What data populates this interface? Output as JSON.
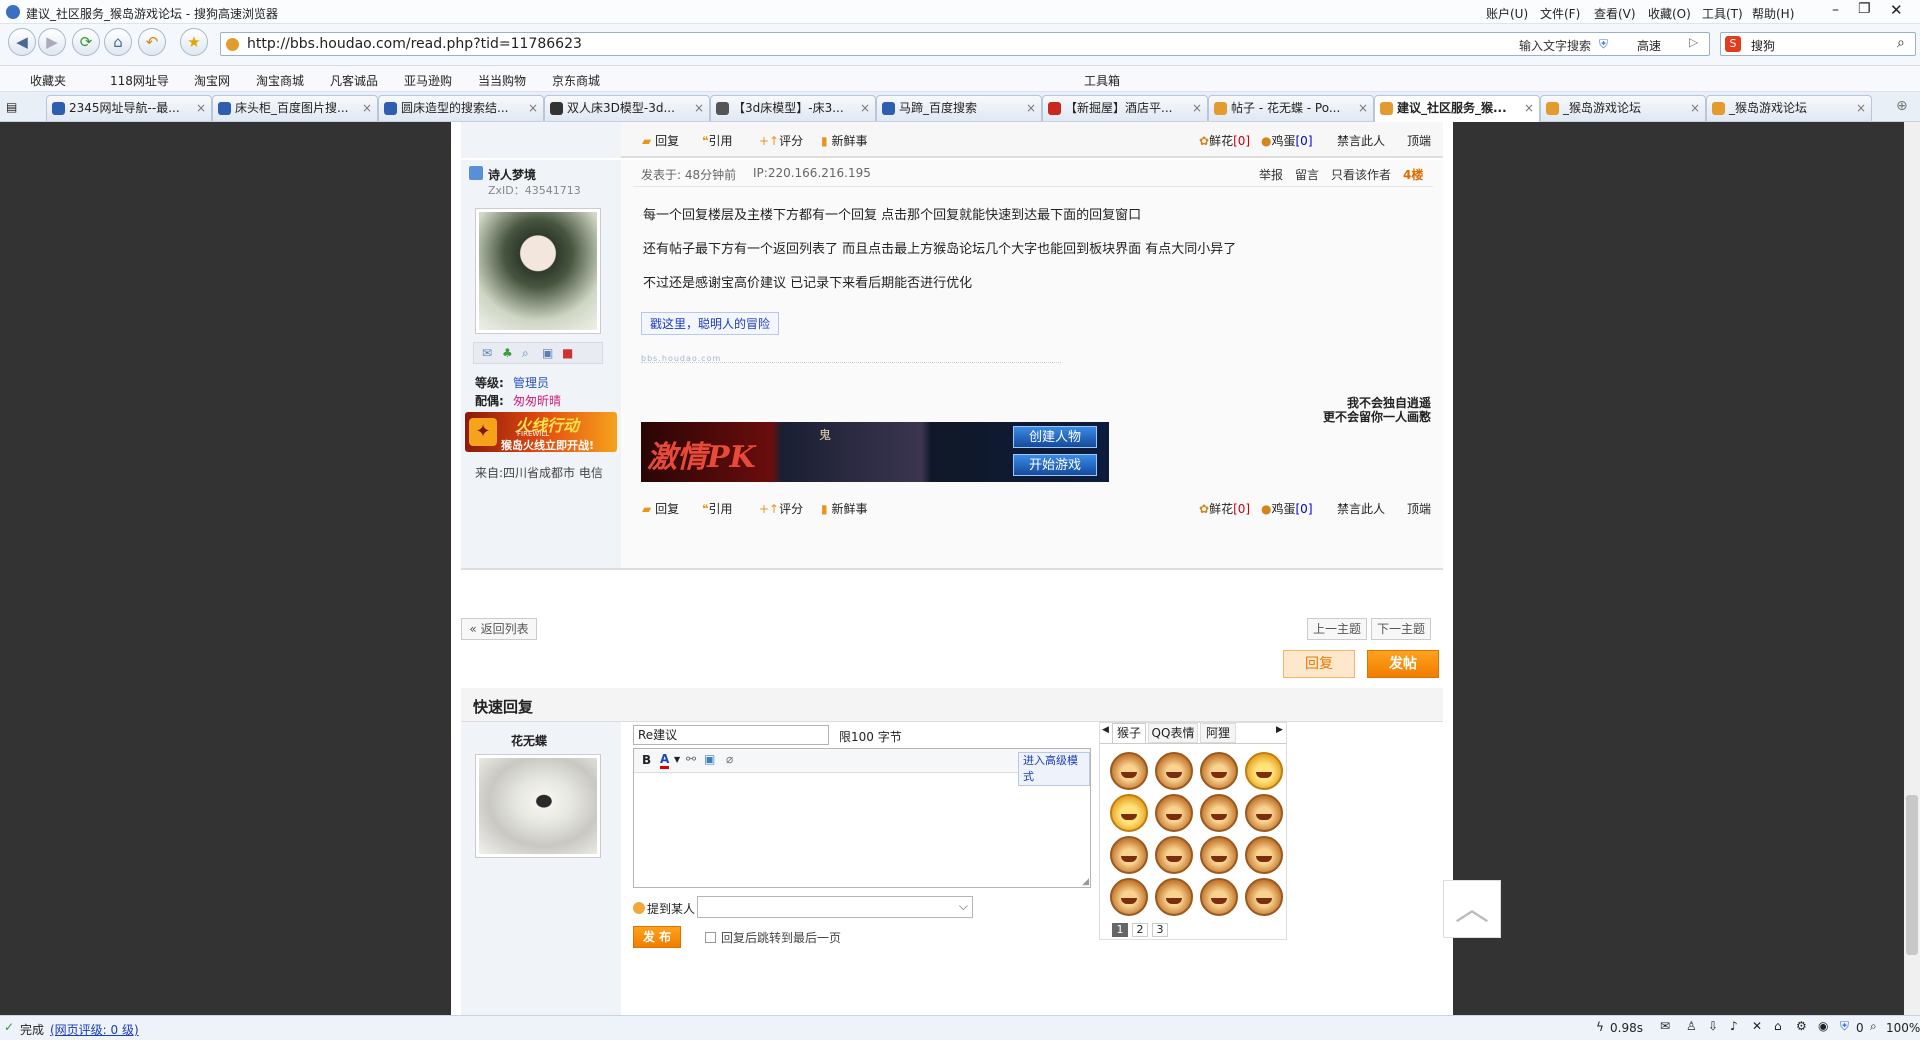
{
  "window": {
    "title": "建议_社区服务_猴岛游戏论坛 - 搜狗高速浏览器",
    "menus": [
      "账户(U)",
      "文件(F)",
      "查看(V)",
      "收藏(O)",
      "工具(T)",
      "帮助(H)"
    ]
  },
  "nav": {
    "url": "http://bbs.houdao.com/read.php?tid=11786623",
    "search_hint": "输入文字搜索",
    "speed_label": "高速",
    "search_engine": "搜狗"
  },
  "favorites": {
    "label": "收藏夹",
    "items": [
      "118网址导",
      "淘宝网",
      "淘宝商城",
      "凡客诚品",
      "亚马逊购",
      "当当购物",
      "京东商城"
    ],
    "toolbox": "工具箱"
  },
  "tabs": [
    "2345网址导航--最...",
    "床头柜_百度图片搜...",
    "圆床造型的搜索结...",
    "双人床3D模型-3d...",
    "【3d床模型】-床3...",
    "马蹄_百度搜索",
    "【新掘屋】酒店平...",
    "帖子 - 花无蝶 - Po...",
    "建议_社区服务_猴...",
    "_猴岛游戏论坛",
    "_猴岛游戏论坛"
  ],
  "post": {
    "actions": [
      "回复",
      "引用",
      "评分",
      "新鲜事"
    ],
    "right_actions": {
      "flower": "鲜花",
      "flower_count": "[0]",
      "egg": "鸡蛋",
      "egg_count": "[0]",
      "ban": "禁言此人",
      "top": "顶端"
    },
    "user": {
      "name": "诗人梦境",
      "uid": "ZxID：43541713",
      "level_label": "等级:",
      "level": "管理员",
      "partner_label": "配偶:",
      "partner": "匆匆昕晴",
      "from": "来自:四川省成都市 电信"
    },
    "meta": {
      "time": "发表于: 48分钟前",
      "ip": "IP:220.166.216.195",
      "report": "举报",
      "msg": "留言",
      "only_author": "只看该作者",
      "floor": "4楼"
    },
    "body": [
      "每一个回复楼层及主楼下方都有一个回复 点击那个回复就能快速到达最下面的回复窗口",
      "还有帖子最下方有一个返回列表了 而且点击最上方猴岛论坛几个大字也能回到板块界面 有点大同小异了",
      "不过还是感谢宝高价建议  已记录下来看后期能否进行优化"
    ],
    "link": "戳这里，聪明人的冒险",
    "watermark": "bbs.houdao.com",
    "signature": [
      "我不会独自逍遥",
      "更不会留你一人画憝"
    ],
    "banner": {
      "left": "激情PK",
      "title": "鬼",
      "create": "创建人物",
      "start": "开始游戏"
    },
    "ad": {
      "line1": "火线行动",
      "line2": "FIREWILL",
      "line3": "猴岛火线立即开战!"
    }
  },
  "pager": {
    "back": "« 返回列表",
    "prev": "上一主题",
    "next": "下一主题",
    "reply": "回复",
    "post": "发帖"
  },
  "quick": {
    "heading": "快速回复",
    "user": "花无蝶",
    "subject": "Re建议",
    "limit": "限100 字节",
    "advanced": "进入高级模式",
    "mention": "提到某人：",
    "submit": "发 布",
    "jump": "回复后跳转到最后一页",
    "emoji_tabs": [
      "猴子",
      "QQ表情",
      "阿狸"
    ],
    "pages": [
      "1",
      "2",
      "3"
    ]
  },
  "status": {
    "done": "完成",
    "rating": "(网页评级: 0 级)",
    "time": "0.98s",
    "zoom": "100%",
    "count": "0"
  }
}
